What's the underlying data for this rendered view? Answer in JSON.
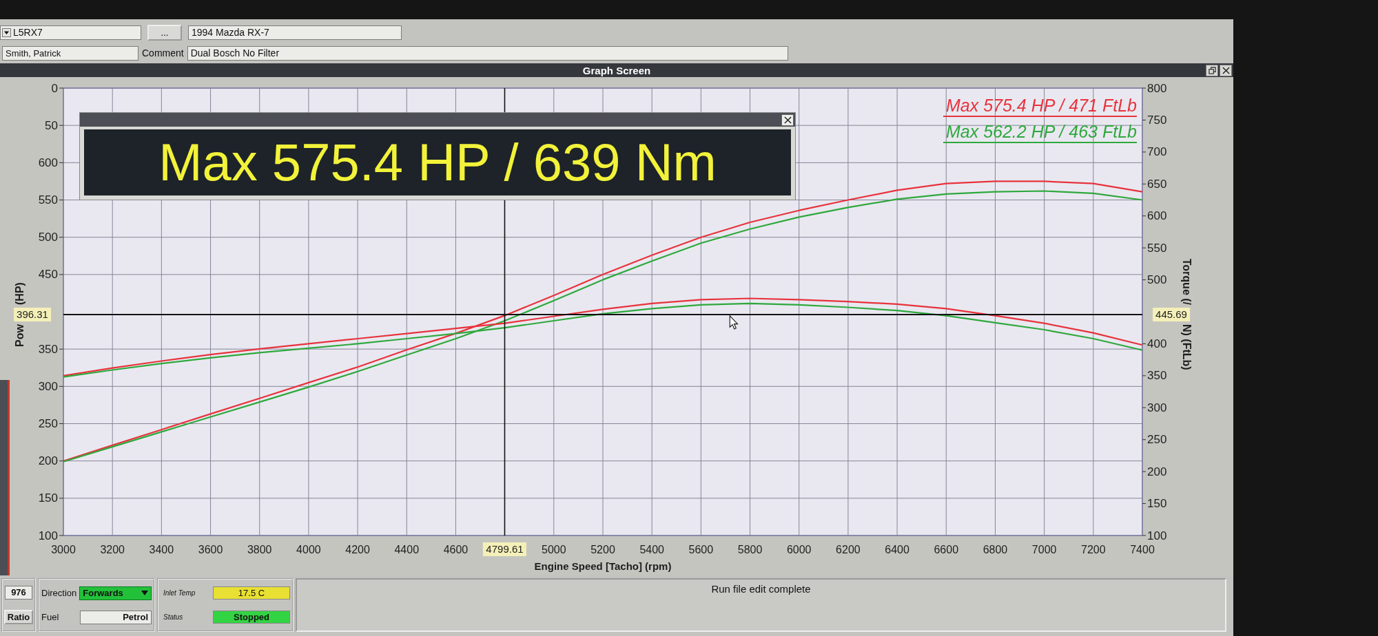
{
  "header": {
    "vehicle_dropdown": {
      "value": "L5RX7"
    },
    "browse_button": {
      "label": "..."
    },
    "vehicle_field": {
      "value": "1994 Mazda RX-7"
    },
    "name_field": {
      "value": "Smith, Patrick"
    },
    "comment": {
      "label": "Comment",
      "value": "Dual Bosch No Filter"
    }
  },
  "window": {
    "title": "Graph Screen"
  },
  "chart": {
    "legend": [
      {
        "text": "Max 575.4 HP / 471 FtLb",
        "color": "#e8323c"
      },
      {
        "text": "Max 562.2 HP / 463 FtLb",
        "color": "#2ea83c"
      }
    ],
    "popup": {
      "text": "Max 575.4 HP / 639 Nm"
    },
    "y_title": [
      "Pow",
      "(HP)"
    ],
    "y2_title": [
      "Torque (/",
      "N) (FtLb)"
    ],
    "cut_tick_labels": [
      "0",
      "50"
    ],
    "y2_cursor_readout": "445.69",
    "chart_data": {
      "type": "line",
      "xlabel": "Engine Speed [Tacho] (rpm)",
      "grid": true,
      "x": [
        3000,
        3200,
        3400,
        3600,
        3800,
        4000,
        4200,
        4400,
        4600,
        4800,
        5000,
        5200,
        5400,
        5600,
        5800,
        6000,
        6200,
        6400,
        6600,
        6800,
        7000,
        7200,
        7400
      ],
      "xlim": [
        3000,
        7400
      ],
      "ylim": [
        100,
        700
      ],
      "y2lim": [
        100,
        800
      ],
      "xticks": [
        3000,
        3200,
        3400,
        3600,
        3800,
        4000,
        4200,
        4400,
        4600,
        5000,
        5200,
        5400,
        5600,
        5800,
        6000,
        6200,
        6400,
        6600,
        6800,
        7000,
        7200,
        7400
      ],
      "yticks": [
        600,
        550,
        500,
        450,
        350,
        300,
        250,
        200,
        150,
        100
      ],
      "y2ticks": [
        800,
        750,
        700,
        650,
        600,
        550,
        500,
        400,
        350,
        300,
        250,
        200,
        150,
        100
      ],
      "series": [
        {
          "color": "#e8323c",
          "values": [
            200,
            221,
            242,
            263,
            284,
            305,
            326,
            349,
            371,
            395,
            422,
            450,
            476,
            500,
            520,
            536,
            550,
            563,
            572,
            575,
            575,
            572,
            561
          ]
        },
        {
          "color": "#2ea83c",
          "values": [
            199,
            219,
            239,
            259,
            279,
            299,
            320,
            342,
            364,
            388,
            415,
            443,
            468,
            492,
            511,
            527,
            540,
            551,
            558,
            561,
            562,
            559,
            550
          ]
        },
        {
          "axis": "y2",
          "color": "#e8323c",
          "values": [
            350,
            362,
            373,
            383,
            392,
            400,
            408,
            416,
            424,
            432,
            443,
            454,
            463,
            469,
            471,
            469,
            466,
            462,
            455,
            444,
            432,
            417,
            398
          ]
        },
        {
          "axis": "y2",
          "color": "#2ea83c",
          "values": [
            348,
            359,
            369,
            378,
            386,
            393,
            400,
            408,
            416,
            425,
            436,
            447,
            455,
            461,
            463,
            461,
            457,
            452,
            444,
            433,
            422,
            408,
            390
          ]
        }
      ],
      "ref_lines": [
        {
          "axis": "x",
          "value": 4799.61,
          "label": "4799.61"
        },
        {
          "axis": "y",
          "value": 396.31,
          "label": "396.31"
        }
      ]
    }
  },
  "bottom_panel": {
    "number_field": {
      "value": "976"
    },
    "ratio_box": {
      "label": "Ratio"
    },
    "direction": {
      "label": "Direction",
      "value": "Forwards"
    },
    "fuel": {
      "label": "Fuel",
      "value": "Petrol"
    },
    "inlet_temp": {
      "label": "Inlet Temp",
      "value": "17.5 C"
    },
    "status": {
      "label": "Status",
      "value": "Stopped"
    }
  },
  "status_message": {
    "text": "Run file edit complete"
  }
}
